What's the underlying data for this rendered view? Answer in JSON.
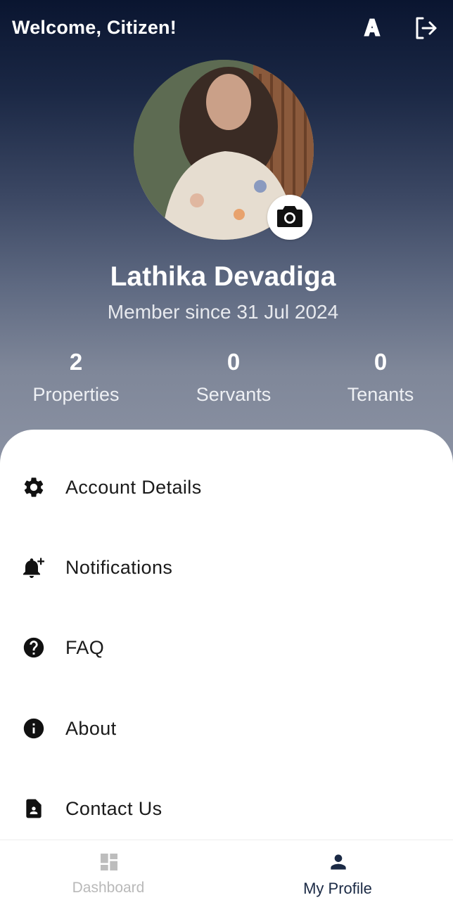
{
  "header": {
    "welcome": "Welcome, Citizen!",
    "language_icon": "font-a-icon",
    "logout_icon": "logout-icon"
  },
  "profile": {
    "name": "Lathika Devadiga",
    "member_since": "Member since 31 Jul 2024",
    "camera_icon": "camera-icon"
  },
  "stats": [
    {
      "value": "2",
      "label": "Properties"
    },
    {
      "value": "0",
      "label": "Servants"
    },
    {
      "value": "0",
      "label": "Tenants"
    }
  ],
  "menu": [
    {
      "label": "Account Details",
      "icon": "gear-icon"
    },
    {
      "label": "Notifications",
      "icon": "bell-plus-icon"
    },
    {
      "label": "FAQ",
      "icon": "help-circle-icon"
    },
    {
      "label": "About",
      "icon": "info-icon"
    },
    {
      "label": "Contact Us",
      "icon": "contact-card-icon"
    }
  ],
  "bottom_nav": {
    "dashboard": "Dashboard",
    "profile": "My Profile"
  },
  "colors": {
    "header_dark": "#0a1530",
    "active_nav": "#1b2a45",
    "inactive_nav": "#b9b9b9"
  }
}
